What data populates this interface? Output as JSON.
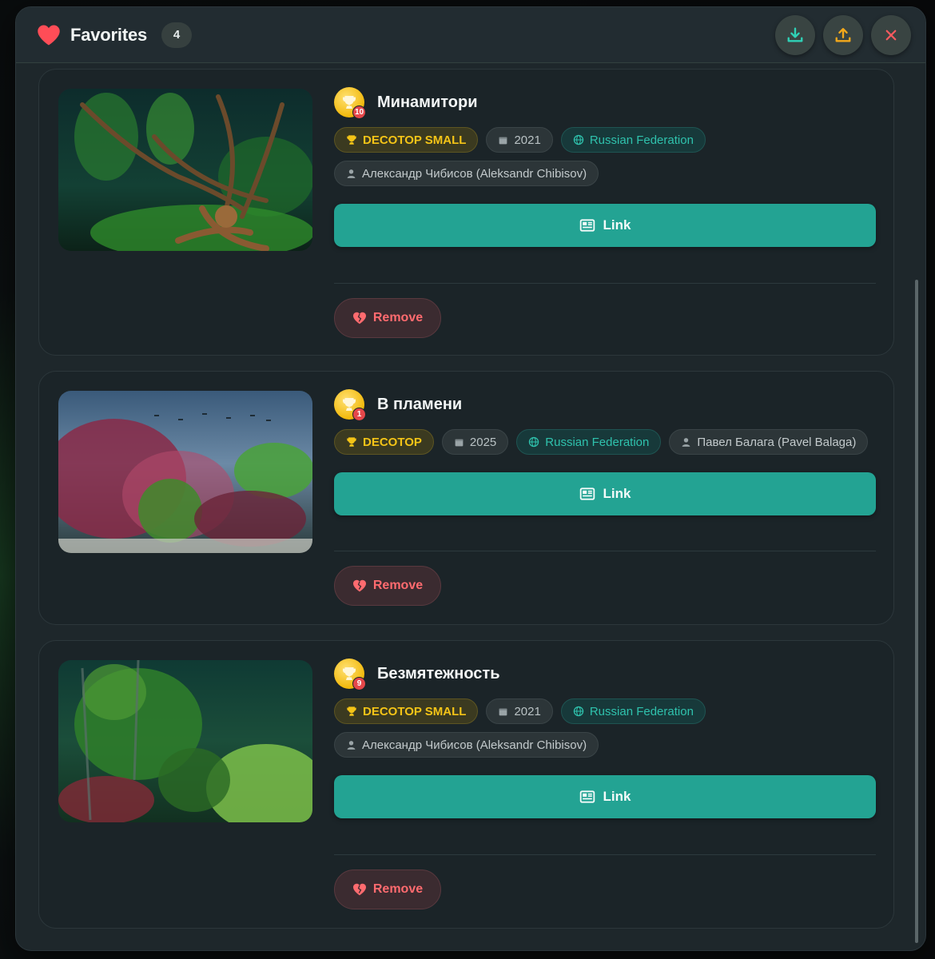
{
  "header": {
    "title": "Favorites",
    "count": "4",
    "icons": [
      "heart-icon",
      "download-icon",
      "upload-icon",
      "close-icon"
    ],
    "accent_colors": {
      "download": "#2fd1b6",
      "upload": "#f3a81b",
      "close": "#ff5a5f",
      "heart": "#ff4d57"
    }
  },
  "entries": [
    {
      "rank": "10",
      "title": "Минамитори",
      "contest": "DECOTOP SMALL",
      "year": "2021",
      "country": "Russian Federation",
      "author": "Александр Чибисов (Aleksandr Chibisov)",
      "link_label": "Link",
      "remove_label": "Remove"
    },
    {
      "rank": "1",
      "title": "В пламени",
      "contest": "DECOTOP",
      "year": "2025",
      "country": "Russian Federation",
      "author": "Павел Балага (Pavel Balaga)",
      "link_label": "Link",
      "remove_label": "Remove"
    },
    {
      "rank": "9",
      "title": "Безмятежность",
      "contest": "DECOTOP SMALL",
      "year": "2021",
      "country": "Russian Federation",
      "author": "Александр Чибисов (Aleksandr Chibisov)",
      "link_label": "Link",
      "remove_label": "Remove"
    }
  ]
}
